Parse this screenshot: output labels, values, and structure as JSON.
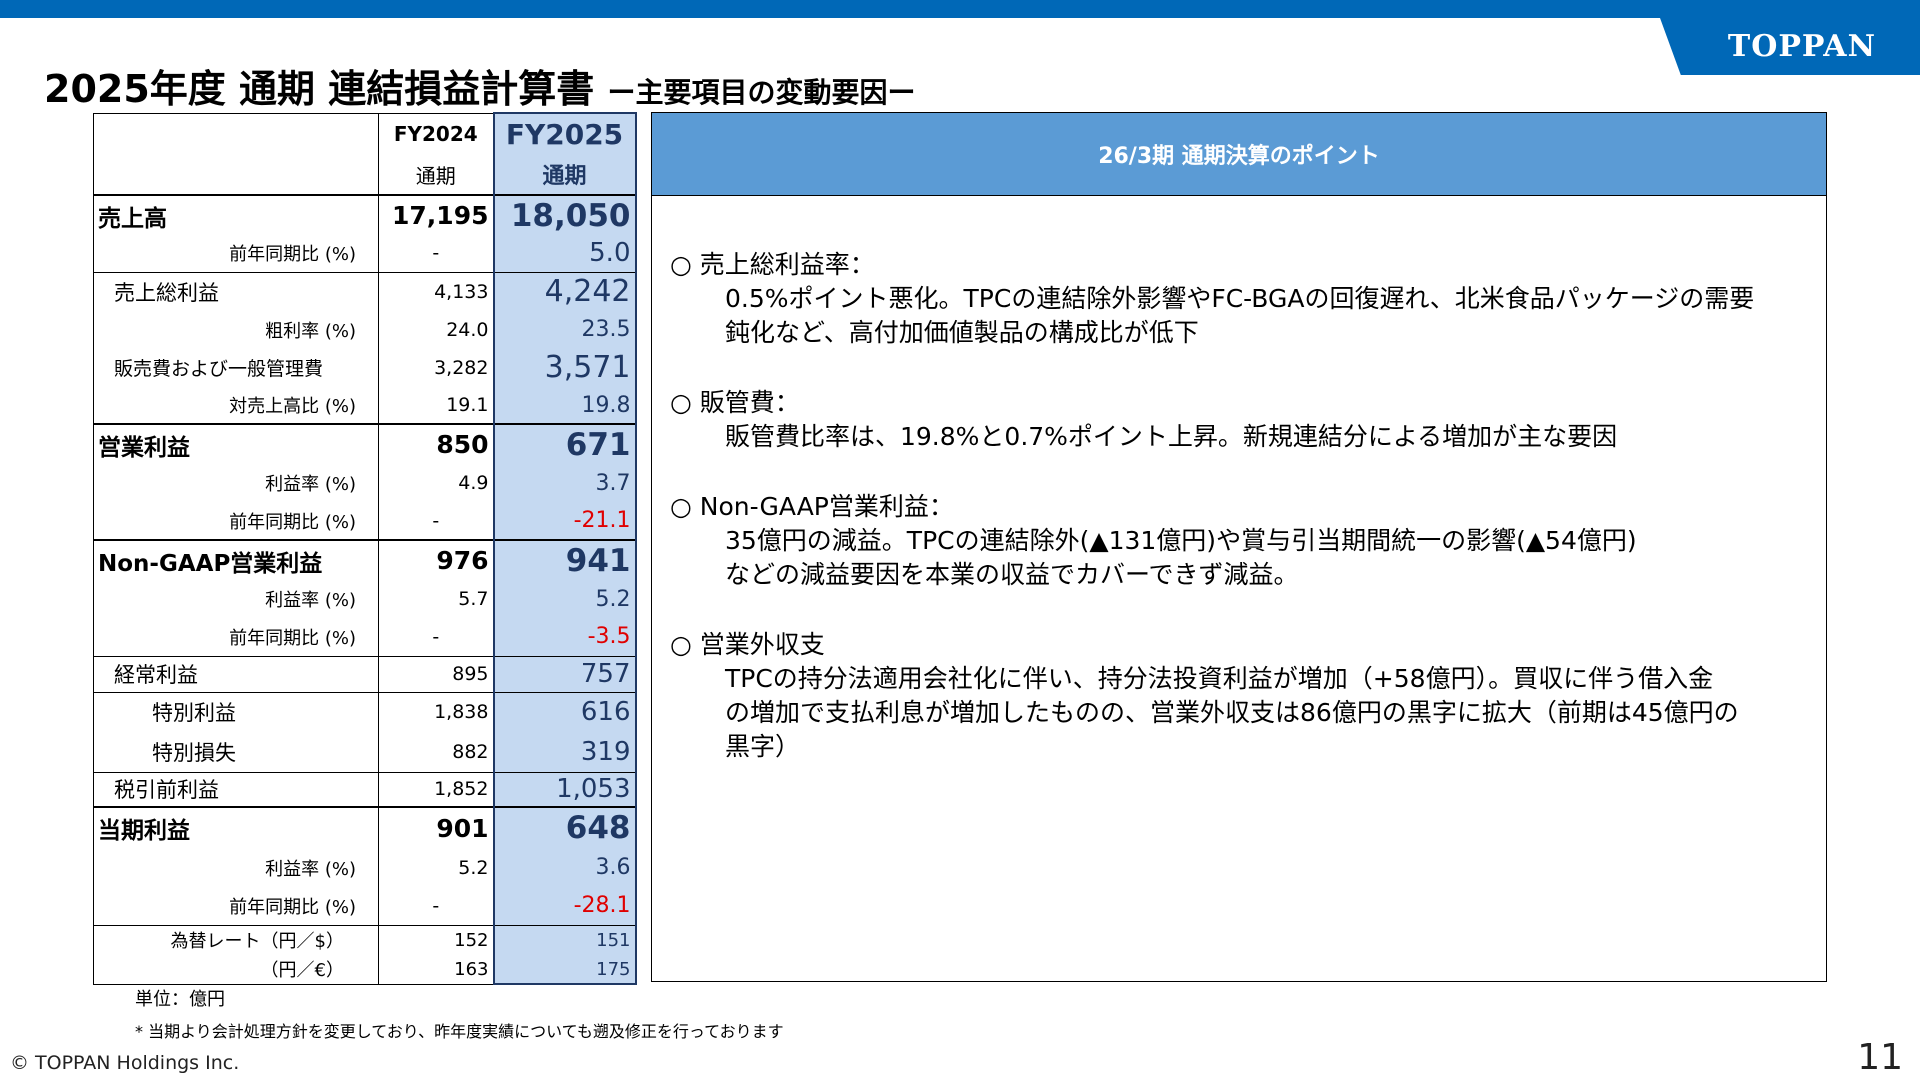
{
  "brand": {
    "logo": "TOPPAN"
  },
  "title": {
    "main": "2025年度 通期 連結損益計算書",
    "sub": "ー主要項目の変動要因ー"
  },
  "table": {
    "col_fy2024": "FY2024",
    "col_fy2025": "FY2025",
    "sub_fy2024": "通期",
    "sub_fy2025": "通期",
    "rows": [
      {
        "label": "売上高",
        "fy2024": "17,195",
        "fy2025": "18,050"
      },
      {
        "label": "前年同期比 (%)",
        "fy2024": "-",
        "fy2025": "5.0"
      },
      {
        "label": "売上総利益",
        "fy2024": "4,133",
        "fy2025": "4,242"
      },
      {
        "label": "粗利率 (%)",
        "fy2024": "24.0",
        "fy2025": "23.5"
      },
      {
        "label": "販売費および一般管理費",
        "fy2024": "3,282",
        "fy2025": "3,571"
      },
      {
        "label": "対売上高比 (%)",
        "fy2024": "19.1",
        "fy2025": "19.8"
      },
      {
        "label": "営業利益",
        "fy2024": "850",
        "fy2025": "671"
      },
      {
        "label": "利益率 (%)",
        "fy2024": "4.9",
        "fy2025": "3.7"
      },
      {
        "label": "前年同期比 (%)",
        "fy2024": "-",
        "fy2025": "-21.1"
      },
      {
        "label": "Non-GAAP営業利益",
        "fy2024": "976",
        "fy2025": "941"
      },
      {
        "label": "利益率 (%)",
        "fy2024": "5.7",
        "fy2025": "5.2"
      },
      {
        "label": "前年同期比 (%)",
        "fy2024": "-",
        "fy2025": "-3.5"
      },
      {
        "label": "経常利益",
        "fy2024": "895",
        "fy2025": "757"
      },
      {
        "label": "特別利益",
        "fy2024": "1,838",
        "fy2025": "616"
      },
      {
        "label": "特別損失",
        "fy2024": "882",
        "fy2025": "319"
      },
      {
        "label": "税引前利益",
        "fy2024": "1,852",
        "fy2025": "1,053"
      },
      {
        "label": "当期利益",
        "fy2024": "901",
        "fy2025": "648"
      },
      {
        "label": "利益率 (%)",
        "fy2024": "5.2",
        "fy2025": "3.6"
      },
      {
        "label": "前年同期比 (%)",
        "fy2024": "-",
        "fy2025": "-28.1"
      },
      {
        "label": "為替レート（円／$）",
        "fy2024": "152",
        "fy2025": "151"
      },
      {
        "label": "（円／€）",
        "fy2024": "163",
        "fy2025": "175"
      }
    ]
  },
  "notes": {
    "unit": "単位：億円",
    "footnote": "* 当期より会計処理方針を変更しており、昨年度実績についても遡及修正を行っております"
  },
  "panel": {
    "title": "26/3期 通期決算のポイント",
    "points": [
      {
        "head": "○ 売上総利益率：",
        "body": [
          "0.5%ポイント悪化。TPCの連結除外影響やFC-BGAの回復遅れ、北米食品パッケージの需要",
          "鈍化など、高付加価値製品の構成比が低下"
        ]
      },
      {
        "head": "○ 販管費：",
        "body": [
          "販管費比率は、19.8%と0.7%ポイント上昇。新規連結分による増加が主な要因"
        ]
      },
      {
        "head": "○ Non-GAAP営業利益：",
        "body": [
          "35億円の減益。TPCの連結除外(▲131億円)や賞与引当期間統一の影響(▲54億円)",
          "などの減益要因を本業の収益でカバーできず減益。"
        ]
      },
      {
        "head": "○ 営業外収支",
        "body": [
          "TPCの持分法適用会社化に伴い、持分法投資利益が増加（+58億円）。買収に伴う借入金",
          "の増加で支払利息が増加したものの、営業外収支は86億円の黒字に拡大（前期は45億円の",
          "黒字）"
        ]
      }
    ]
  },
  "footer": {
    "copyright": "© TOPPAN Holdings Inc.",
    "page": "11"
  },
  "colors": {
    "brand_blue": "#0068b7",
    "panel_header": "#5b9bd5",
    "fy2025_fill": "#c5d9f1",
    "negative": "#e00000"
  }
}
